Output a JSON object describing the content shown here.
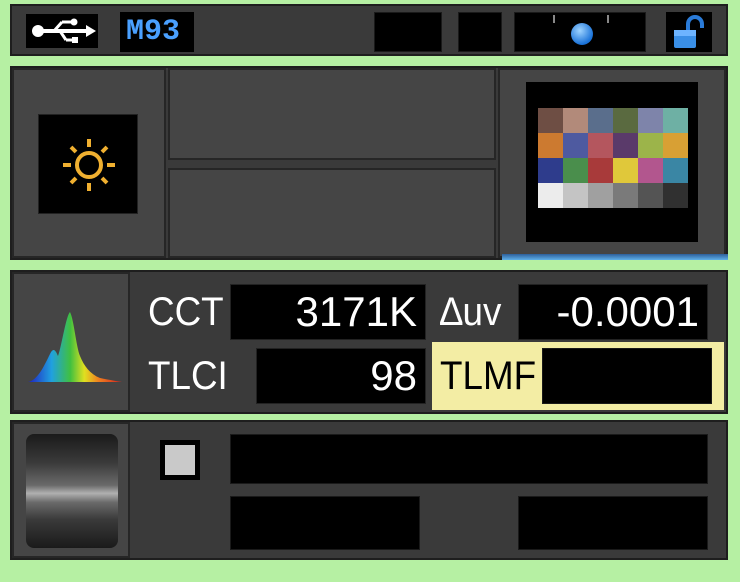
{
  "status_bar": {
    "usb_icon": "usb-icon",
    "mode_label": "M93",
    "lock_icon": "unlock-icon"
  },
  "top_panel": {
    "light_icon": "sun-icon",
    "colorchecker_swatches": [
      "#6e4e44",
      "#b28a7a",
      "#5a6e8c",
      "#5a6a40",
      "#7e84aa",
      "#6eb0a4",
      "#cc7a30",
      "#4e5aa0",
      "#b4565e",
      "#5a3a6a",
      "#9cb44a",
      "#d8a034",
      "#2e3c8c",
      "#4a8e4c",
      "#a83a3a",
      "#e0c83a",
      "#b2568e",
      "#3a86a4",
      "#ececec",
      "#c4c4c4",
      "#a0a0a0",
      "#7a7a7a",
      "#545454",
      "#303030"
    ]
  },
  "measure_panel": {
    "spectrum_icon": "spectrum-icon",
    "cct_label": "CCT",
    "cct_value": "3171K",
    "duv_label": "∆uv",
    "duv_value": "-0.0001",
    "tlci_label": "TLCI",
    "tlci_value": "98",
    "tlmf_label": "TLMF",
    "tlmf_value": ""
  },
  "bottom_panel": {
    "dial_icon": "dial-icon"
  },
  "colors": {
    "background": "#b6f0a3",
    "panel": "#3a3a3a",
    "highlight": "#f3eda4",
    "mode_text": "#4aa0ff"
  }
}
